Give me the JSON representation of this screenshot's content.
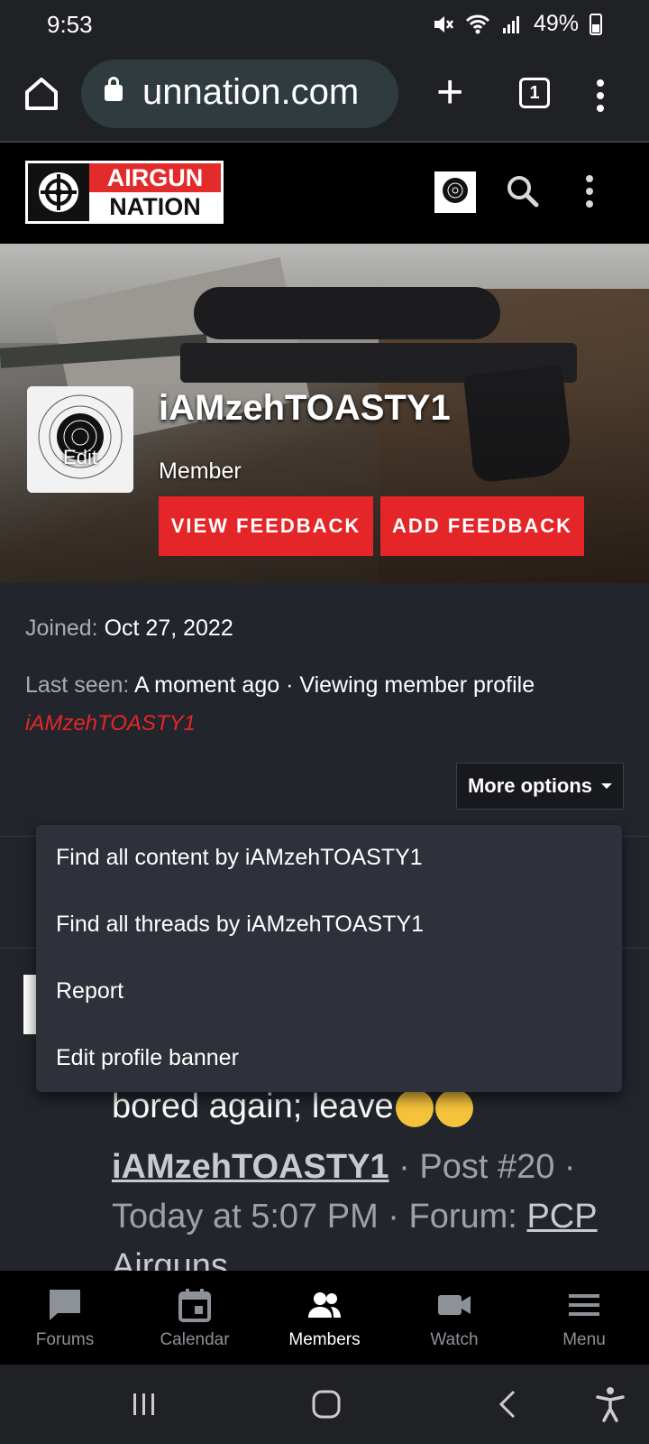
{
  "status_bar": {
    "time": "9:53",
    "battery": "49%",
    "icons": [
      "mute-icon",
      "wifi-icon",
      "signal-icon",
      "battery-icon"
    ]
  },
  "browser": {
    "url": "unnation.com",
    "tab_count": "1"
  },
  "site": {
    "logo_line1": "AIRGUN",
    "logo_line2": "NATION"
  },
  "profile": {
    "username": "iAMzehTOASTY1",
    "role": "Member",
    "avatar_edit_label": "Edit",
    "view_feedback_label": "VIEW FEEDBACK",
    "add_feedback_label": "ADD FEEDBACK",
    "joined_label": "Joined:",
    "joined_value": "Oct 27, 2022",
    "last_seen_label": "Last seen:",
    "last_seen_value": "A moment ago · Viewing member profile",
    "last_seen_link": "iAMzehTOASTY1",
    "more_options_label": "More options"
  },
  "dropdown": {
    "items": [
      "Find all content by iAMzehTOASTY1",
      "Find all threads by iAMzehTOASTY1",
      "Report",
      "Edit profile banner"
    ]
  },
  "post": {
    "snippet": "bored again; leave",
    "author": "iAMzehTOASTY1",
    "post_number": "Post #20",
    "time": "Today at 5:07 PM",
    "forum_label": "Forum:",
    "forum_name": "PCP Airguns"
  },
  "tabbar": {
    "items": [
      {
        "label": "Forums",
        "icon": "forums-icon",
        "active": false
      },
      {
        "label": "Calendar",
        "icon": "calendar-icon",
        "active": false
      },
      {
        "label": "Members",
        "icon": "members-icon",
        "active": true
      },
      {
        "label": "Watch",
        "icon": "video-icon",
        "active": false
      },
      {
        "label": "Menu",
        "icon": "menu-icon",
        "active": false
      }
    ]
  },
  "colors": {
    "accent_red": "#e52628",
    "background": "#22252c",
    "header_black": "#000000"
  }
}
